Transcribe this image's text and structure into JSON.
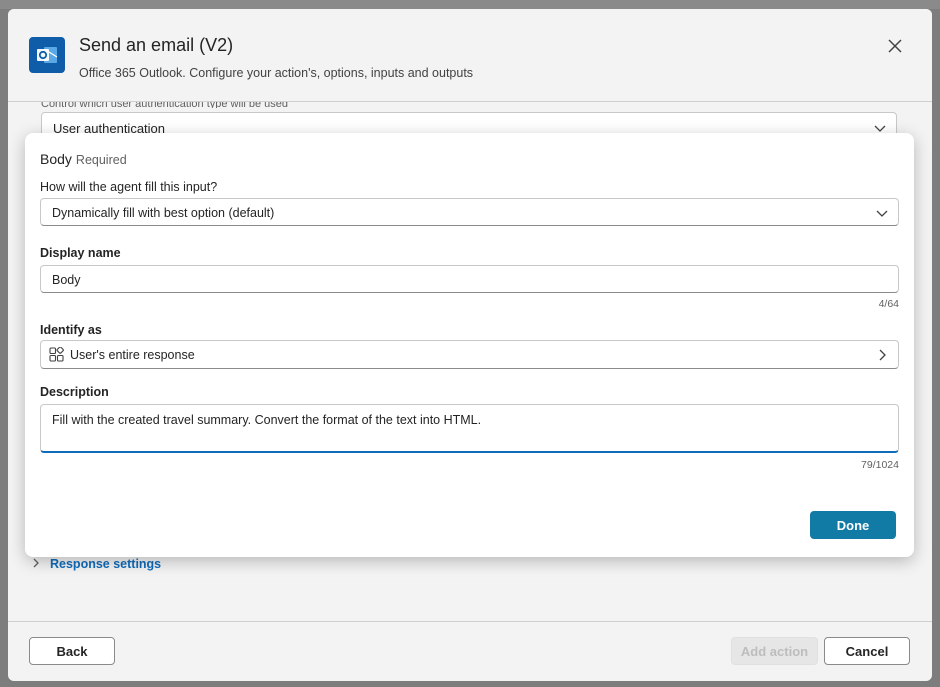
{
  "panel": {
    "title": "Send an email (V2)",
    "subtitle": "Office 365 Outlook. Configure your action's, options, inputs and outputs",
    "icon": "outlook-icon",
    "close_icon": "close-icon"
  },
  "auth": {
    "hint": "Control which user authentication type will be used",
    "value": "User authentication"
  },
  "response_settings_label": "Response settings",
  "footer": {
    "back_label": "Back",
    "add_action_label": "Add action",
    "cancel_label": "Cancel"
  },
  "dialog": {
    "title": "Body",
    "required": "Required",
    "fill_question": "How will the agent fill this input?",
    "fill_value": "Dynamically fill with best option (default)",
    "display_name_label": "Display name",
    "display_name_value": "Body",
    "display_name_counter": "4/64",
    "identify_as_label": "Identify as",
    "identify_as_value": "User's entire response",
    "identify_as_icon": "entity-grid-icon",
    "description_label": "Description",
    "description_value": "Fill with the created travel summary. Convert the format of the text into HTML.",
    "description_counter": "79/1024",
    "done_label": "Done"
  },
  "colors": {
    "accent": "#117ba6",
    "brand_outlook": "#0f5ca8",
    "link": "#0f6cbd"
  }
}
